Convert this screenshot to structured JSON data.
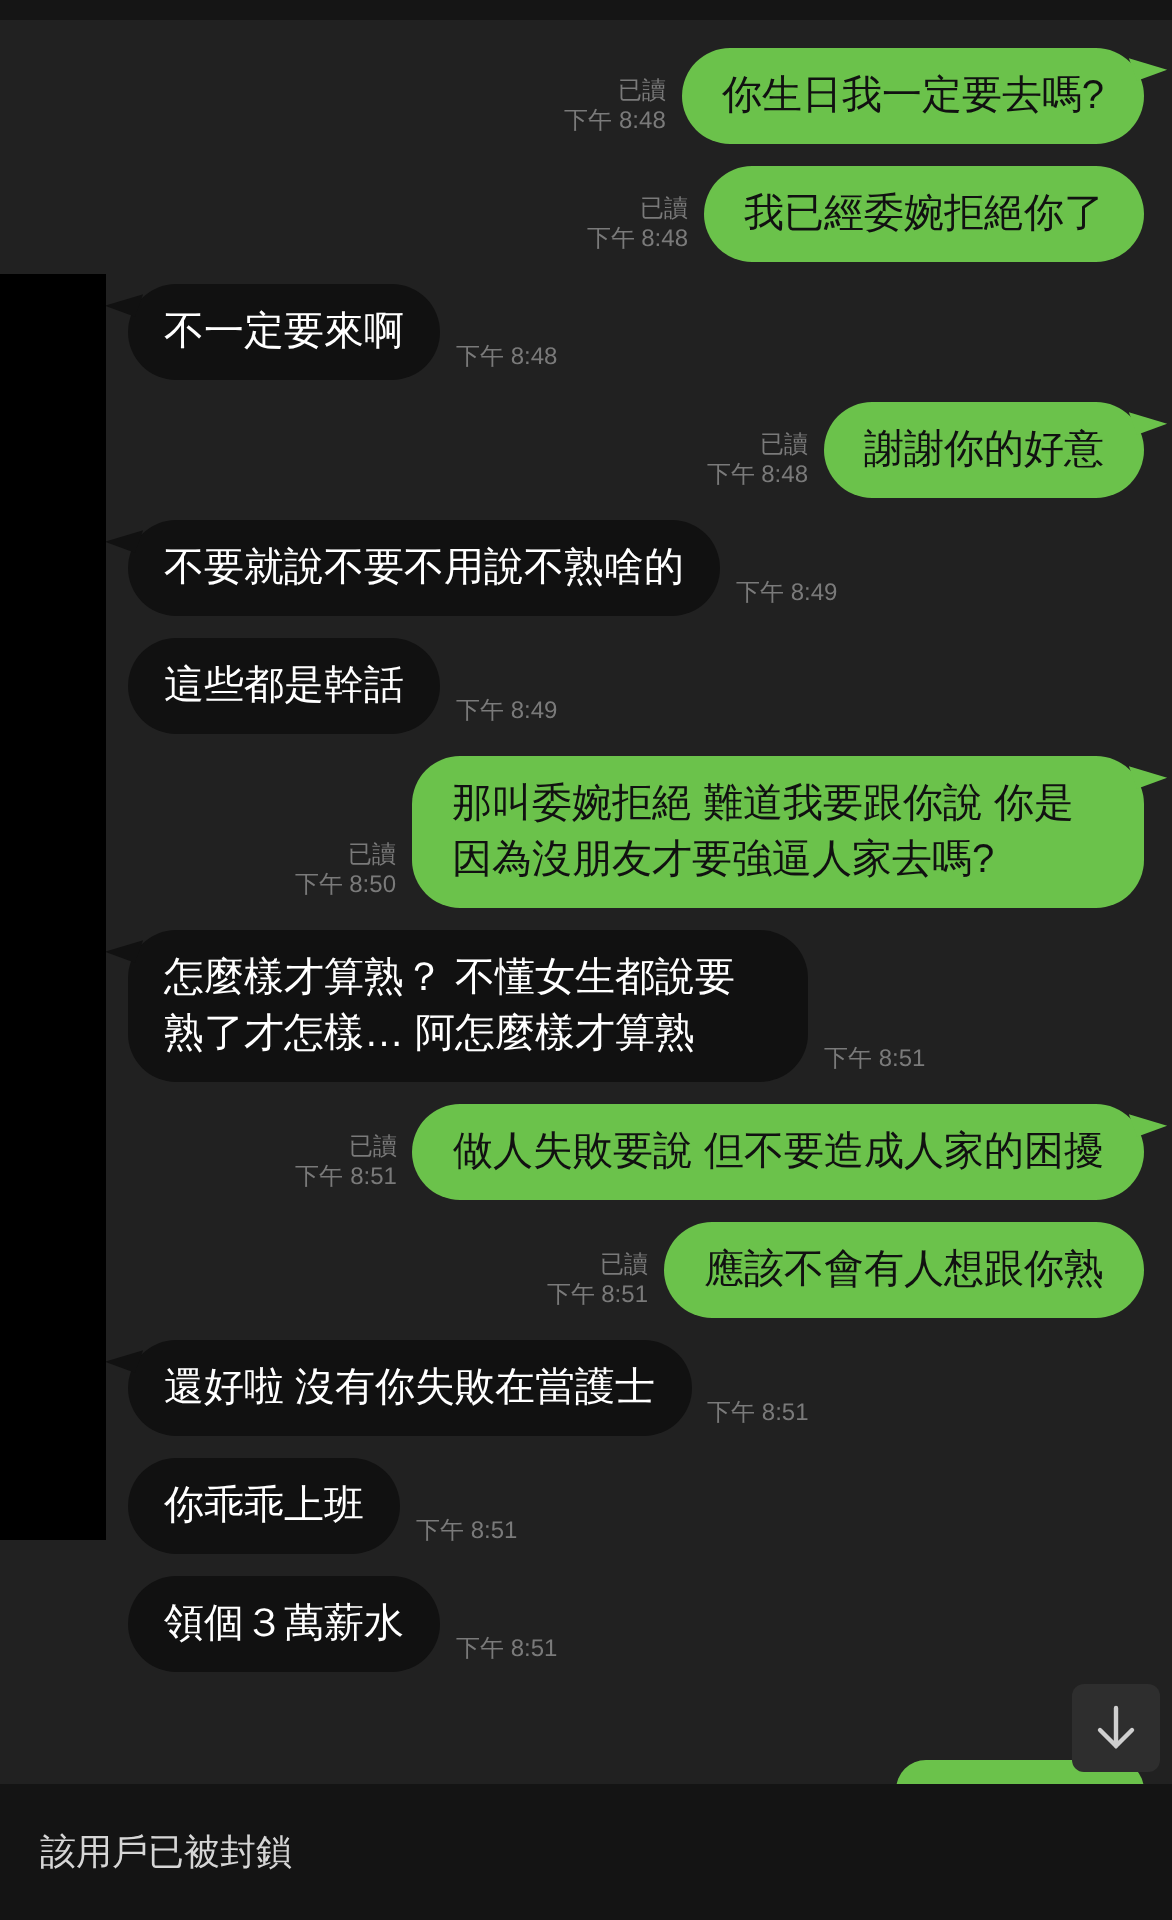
{
  "messages": [
    {
      "kind": "sent",
      "text": "你生日我一定要去嗎?",
      "read": "已讀",
      "time": "下午 8:48",
      "tail": true
    },
    {
      "kind": "sent",
      "text": "我已經委婉拒絕你了",
      "read": "已讀",
      "time": "下午 8:48",
      "tail": false
    },
    {
      "kind": "received",
      "text": "不一定要來啊",
      "time": "下午 8:48",
      "tail": true
    },
    {
      "kind": "sent",
      "text": "謝謝你的好意",
      "read": "已讀",
      "time": "下午 8:48",
      "tail": true
    },
    {
      "kind": "received",
      "text": "不要就說不要不用說不熟啥的",
      "time": "下午 8:49",
      "tail": true
    },
    {
      "kind": "received",
      "text": "這些都是幹話",
      "time": "下午 8:49",
      "tail": false
    },
    {
      "kind": "sent",
      "text": "那叫委婉拒絕 難道我要跟你說 你是因為沒朋友才要強逼人家去嗎?",
      "read": "已讀",
      "time": "下午 8:50",
      "tail": true
    },
    {
      "kind": "received",
      "text": "怎麼樣才算熟？ 不懂女生都說要熟了才怎樣… 阿怎麼樣才算熟",
      "time": "下午 8:51",
      "tail": true
    },
    {
      "kind": "sent",
      "text": "做人失敗要說 但不要造成人家的困擾",
      "read": "已讀",
      "time": "下午 8:51",
      "tail": true
    },
    {
      "kind": "sent",
      "text": "應該不會有人想跟你熟",
      "read": "已讀",
      "time": "下午 8:51",
      "tail": false
    },
    {
      "kind": "received",
      "text": "還好啦 沒有你失敗在當護士",
      "time": "下午 8:51",
      "tail": true
    },
    {
      "kind": "received",
      "text": "你乖乖上班",
      "time": "下午 8:51",
      "tail": false
    },
    {
      "kind": "received",
      "text": "領個３萬薪水",
      "time": "下午 8:51",
      "tail": false
    }
  ],
  "footer": {
    "text": "該用戶已被封鎖"
  }
}
